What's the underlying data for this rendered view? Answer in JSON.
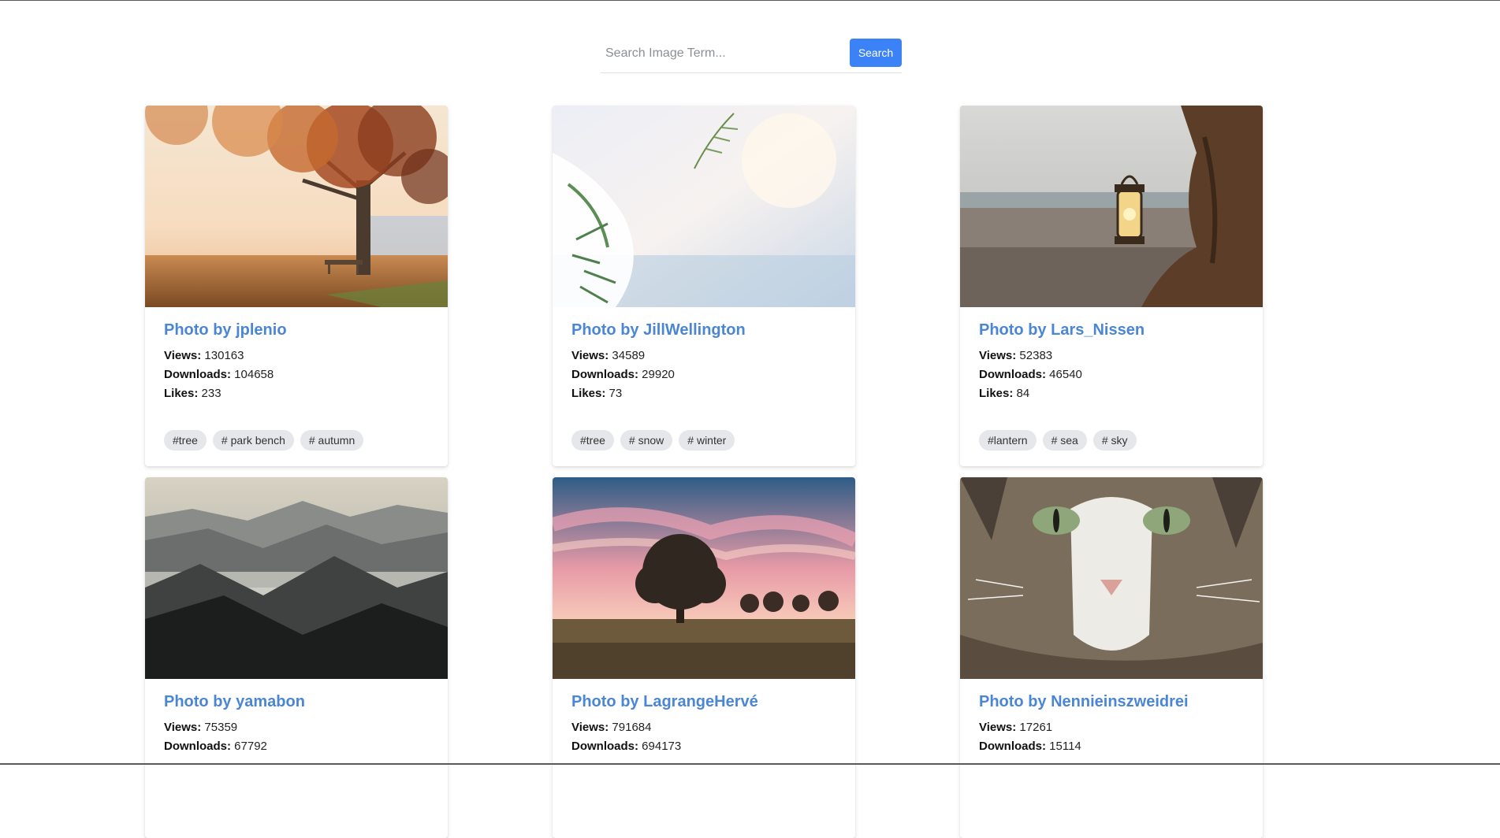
{
  "search": {
    "placeholder": "Search Image Term...",
    "button_label": "Search"
  },
  "labels": {
    "views": "Views:",
    "downloads": "Downloads:",
    "likes": "Likes:"
  },
  "cards": [
    {
      "title": "Photo by jplenio",
      "views": "130163",
      "downloads": "104658",
      "likes": "233",
      "tags": [
        "#tree",
        "# park bench",
        "# autumn"
      ],
      "image": "autumn-tree-with-bench"
    },
    {
      "title": "Photo by JillWellington",
      "views": "34589",
      "downloads": "29920",
      "likes": "73",
      "tags": [
        "#tree",
        "# snow",
        "# winter"
      ],
      "image": "snowy-branch"
    },
    {
      "title": "Photo by Lars_Nissen",
      "views": "52383",
      "downloads": "46540",
      "likes": "84",
      "tags": [
        "#lantern",
        "# sea",
        "# sky"
      ],
      "image": "lantern-on-beach"
    },
    {
      "title": "Photo by yamabon",
      "views": "75359",
      "downloads": "67792",
      "likes": "",
      "tags": [],
      "image": "misty-mountains"
    },
    {
      "title": "Photo by LagrangeHervé",
      "views": "791684",
      "downloads": "694173",
      "likes": "",
      "tags": [],
      "image": "tree-at-sunset"
    },
    {
      "title": "Photo by Nennieinszweidrei",
      "views": "17261",
      "downloads": "15114",
      "likes": "",
      "tags": [],
      "image": "tabby-cat-closeup"
    }
  ],
  "colors": {
    "accent": "#3b82f6",
    "title": "#4a86d4",
    "tag_bg": "#e5e7eb"
  }
}
